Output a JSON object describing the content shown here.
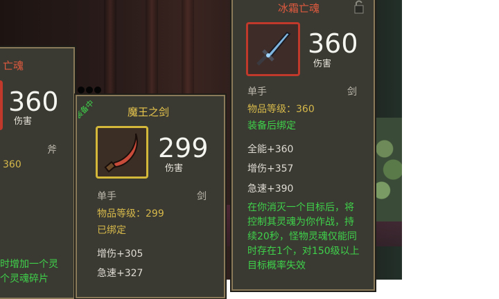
{
  "colors": {
    "title_red": "#e05a3e",
    "gold": "#d6b84a",
    "green": "#3fd14a",
    "panel": "#3a3a33",
    "border": "#8a7a5a"
  },
  "tooltip_left": {
    "title_partial": "亡魂",
    "damage": "360",
    "damage_label": "伤害",
    "slot_type": "斧",
    "item_level_partial": "360",
    "effect_partial": "时增加一个灵\n个灵魂碎片"
  },
  "equipped_badge": "装备中",
  "tooltip_center": {
    "title": "魔王之剑",
    "icon": "curved-blade-icon",
    "damage": "299",
    "damage_label": "伤害",
    "hand": "单手",
    "type": "剑",
    "item_level": "物品等级：299",
    "bind": "已绑定",
    "stats": [
      "增伤+305",
      "急速+327"
    ]
  },
  "tooltip_right": {
    "title": "冰霜亡魂",
    "icon": "frost-sword-icon",
    "damage": "360",
    "damage_label": "伤害",
    "hand": "单手",
    "type": "剑",
    "item_level": "物品等级：360",
    "bind": "装备后绑定",
    "stats": [
      "全能+360",
      "增伤+357",
      "急速+390"
    ],
    "effect": "在你消灭一个目标后，将控制其灵魂为你作战，持续20秒，怪物灵魂仅能同时存在1个，对150级以上目标概率失效"
  }
}
